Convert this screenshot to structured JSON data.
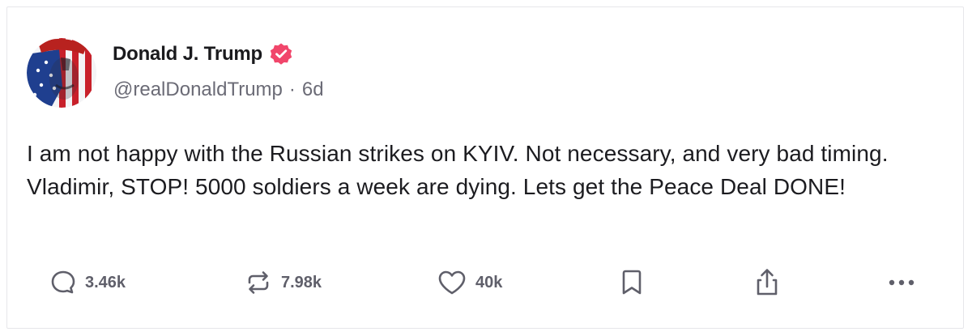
{
  "post": {
    "author": {
      "display_name": "Donald J. Trump",
      "handle": "@realDonaldTrump",
      "separator": "·",
      "time_ago": "6d",
      "verified": true
    },
    "text": "I am not happy with the Russian strikes on KYIV. Not necessary, and very bad timing. Vladimir, STOP! 5000 soldiers a week are dying. Lets get the Peace Deal DONE!",
    "stats": {
      "replies": "3.46k",
      "reposts": "7.98k",
      "likes": "40k"
    },
    "actions": {
      "reply_icon": "comment-icon",
      "repost_icon": "repost-icon",
      "like_icon": "heart-icon",
      "save_icon": "bookmark-icon",
      "share_icon": "share-icon",
      "more_icon": "more-dots-icon"
    }
  },
  "colors": {
    "verified_badge": "#f1466b",
    "text_primary": "#1c1c20",
    "text_secondary": "#6b6b76",
    "icon": "#5f5f6a",
    "border": "#e6e6ea"
  }
}
